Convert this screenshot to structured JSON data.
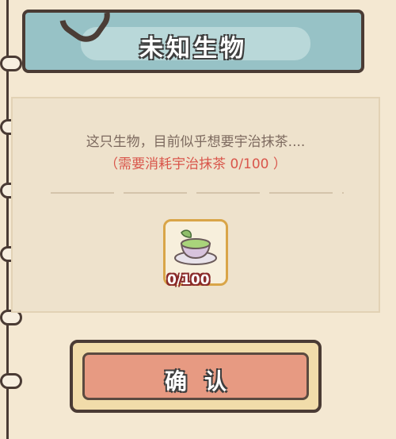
{
  "header": {
    "title": "未知生物"
  },
  "dialog": {
    "description": "这只生物，目前似乎想要宇治抹茶....",
    "requirement": "（需要消耗宇治抹茶 0/100 ）"
  },
  "item": {
    "name_icon": "matcha-tea-icon",
    "count": "0/100"
  },
  "actions": {
    "confirm_label": "确认"
  },
  "colors": {
    "banner": "#97c2c6",
    "confirm": "#e79a82",
    "accent_red": "#d9564b"
  }
}
